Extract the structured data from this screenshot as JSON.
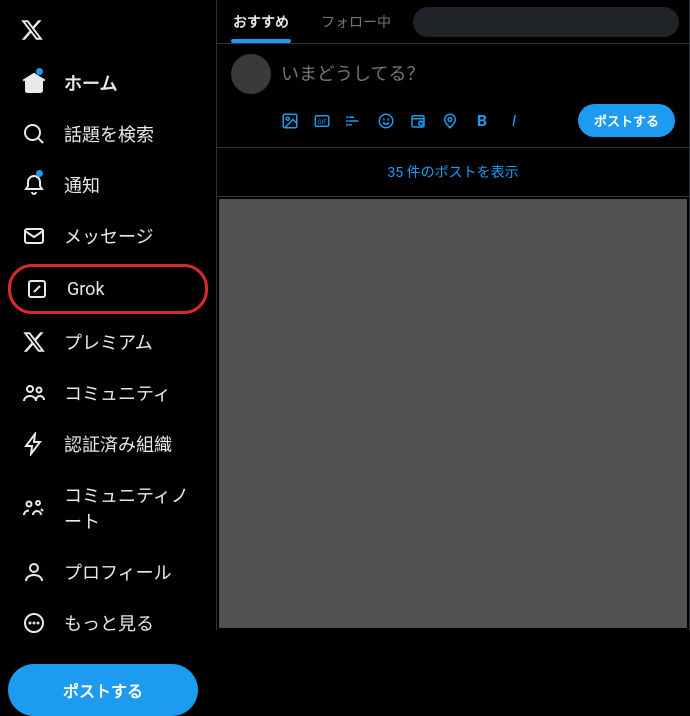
{
  "sidebar": {
    "items": [
      {
        "label": "ホーム"
      },
      {
        "label": "話題を検索"
      },
      {
        "label": "通知"
      },
      {
        "label": "メッセージ"
      },
      {
        "label": "Grok"
      },
      {
        "label": "プレミアム"
      },
      {
        "label": "コミュニティ"
      },
      {
        "label": "認証済み組織"
      },
      {
        "label": "コミュニティノート"
      },
      {
        "label": "プロフィール"
      },
      {
        "label": "もっと見る"
      }
    ],
    "post_button": "ポストする"
  },
  "tabs": {
    "recommended": "おすすめ",
    "following": "フォロー中"
  },
  "compose": {
    "placeholder": "いまどうしてる？",
    "post_button": "ポストする"
  },
  "feed": {
    "show_posts": "35 件のポストを表示"
  }
}
